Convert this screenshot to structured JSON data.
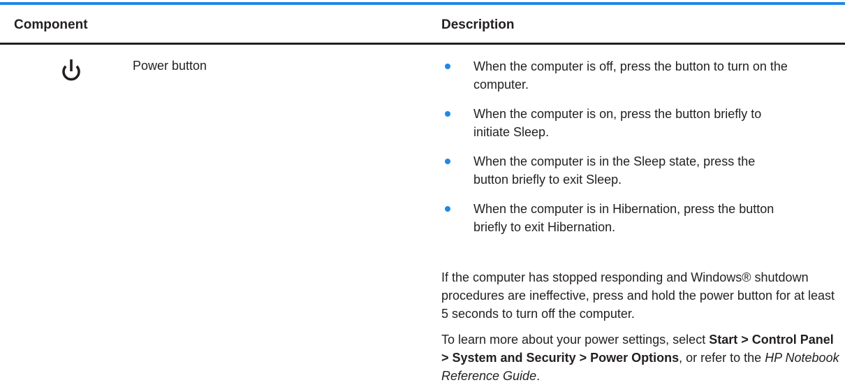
{
  "colors": {
    "accent": "#1e88e5",
    "text": "#231f20",
    "header_rule": "#231f20"
  },
  "table": {
    "headers": {
      "component": "Component",
      "description": "Description"
    },
    "row": {
      "icon": "power-icon",
      "component": "Power button",
      "bullets": [
        "When the computer is off, press the button to turn on the computer.",
        "When the computer is on, press the button briefly to initiate Sleep.",
        "When the computer is in the Sleep state, press the button briefly to exit Sleep.",
        "When the computer is in Hibernation, press the button briefly to exit Hibernation."
      ],
      "paragraph1": "If the computer has stopped responding and Windows® shutdown procedures are ineffective, press and hold the power button for at least 5 seconds to turn off the computer.",
      "paragraph2": {
        "prefix": "To learn more about your power settings, select ",
        "bold_path": "Start > Control Panel > System and Security > Power Options",
        "middle": ", or refer to the ",
        "italic_title": "HP Notebook Reference Guide",
        "suffix": "."
      }
    }
  }
}
